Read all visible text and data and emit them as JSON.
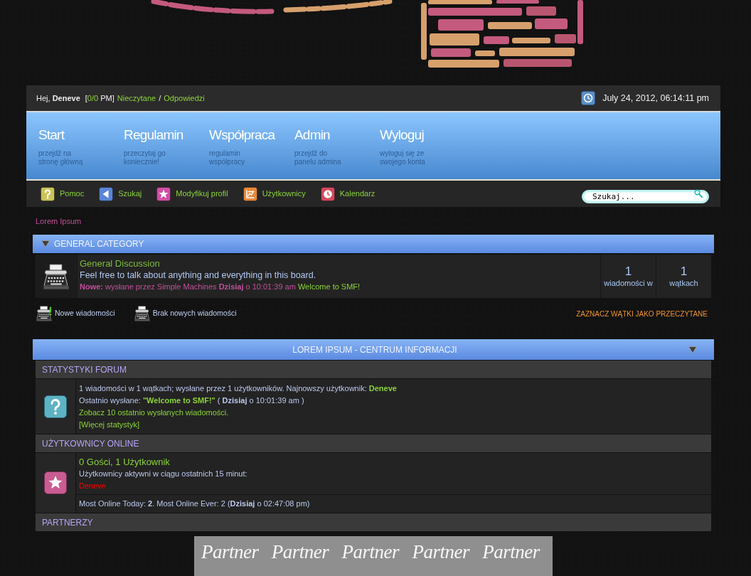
{
  "user_bar": {
    "greeting": "Hej, **Deneve**",
    "pm_open": "[",
    "pm_count": "0/0",
    "pm_close": "PM]",
    "unread_link": "Nieczytane",
    "separator": "/",
    "replies_link": "Odpowiedzi",
    "datetime": "July 24, 2012, 06:14:11 pm"
  },
  "menu": [
    {
      "title": "Start",
      "description": "przejdź na\nstronę główną"
    },
    {
      "title": "Regulamin",
      "description": "przeczytaj go\nkoniecznie!"
    },
    {
      "title": "Współpraca",
      "description": "regulamin\nwspółpracy"
    },
    {
      "title": "Admin",
      "description": "przejdź do\npanelu admina"
    },
    {
      "title": "Wyloguj",
      "description": "wyloguj się ze\nswojego konta"
    }
  ],
  "quick_links": [
    {
      "kind": "help",
      "label": "Pomoc"
    },
    {
      "kind": "search",
      "label": "Szukaj"
    },
    {
      "kind": "profile",
      "label": "Modyfikuj profil"
    },
    {
      "kind": "members",
      "label": "Użytkownicy"
    },
    {
      "kind": "calendar",
      "label": "Kalendarz"
    }
  ],
  "search": {
    "placeholder": "Szukaj..."
  },
  "breadcrumb": [
    "Lorem Ipsum"
  ],
  "category": {
    "title": "GENERAL CATEGORY",
    "boards": [
      {
        "name": "General Discussion",
        "description": "Feel free to talk about anything and everything in this board.",
        "last_post": "**Nowe:** wysłane przez Simple Machines **Dzisiaj** o 10:01:39 am",
        "last_topic": "Welcome to SMF!",
        "stats": [
          {
            "value": "1",
            "label": "wiadomości w"
          },
          {
            "value": "1",
            "label": "wątkach"
          }
        ]
      }
    ]
  },
  "legend": {
    "items": [
      {
        "kind": "new",
        "label": "Nowe wiadomości"
      },
      {
        "kind": "none",
        "label": "Brak nowych wiadomości"
      }
    ],
    "mark_read": "ZAZNACZ WĄTKI JAKO PRZECZYTANE"
  },
  "info_center": {
    "title": "LOREM IPSUM - CENTRUM INFORMACJI",
    "sections": [
      {
        "kind": "stats",
        "title": "STATYSTYKI FORUM",
        "lines": [
          {
            "kind": "text",
            "text": "1 wiadomości w 1 wątkach; wysłane przez 1 użytkowników. Najnowszy użytkownik:",
            "link": "Deneve"
          },
          {
            "kind": "text",
            "text": "Ostatnio wysłane:",
            "link": "\"Welcome to SMF!\"",
            "after": "( **Dzisiaj** o 10:01:39 am )"
          },
          {
            "kind": "link",
            "text": "Zobacz 10 ostatnio wysłanych wiadomości."
          },
          {
            "kind": "link",
            "text": "[Więcej statystyk]"
          }
        ]
      },
      {
        "kind": "online",
        "title": "UŻYTKOWNICY ONLINE",
        "summary": "0 Gości, 1 Użytkownik",
        "caption": "Użytkownicy aktywni w ciągu ostatnich 15 minut:",
        "users": [
          {
            "name": "Deneve",
            "color": "#ff0000"
          }
        ],
        "record": "Most Online Today: **2**. Most Online Ever: 2 (**Dzisiaj** o 02:47:08 pm)"
      },
      {
        "kind": "partners",
        "title": "PARTNERZY",
        "banner": [
          "Partner",
          "Partner",
          "Partner",
          "Partner",
          "Partner"
        ]
      }
    ]
  }
}
